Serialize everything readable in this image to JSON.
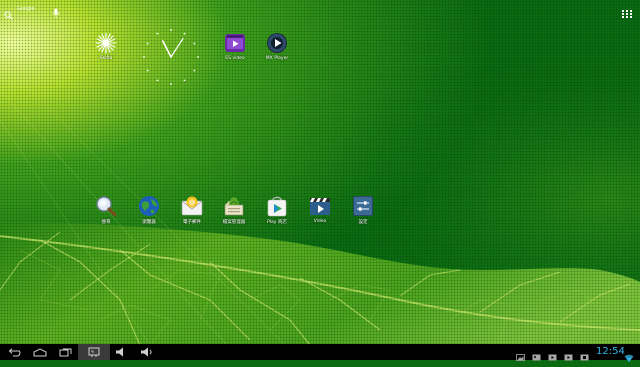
{
  "search": {
    "label": "Google"
  },
  "clock": {
    "hour_hand_angle": 333,
    "minute_hand_angle": 33
  },
  "top_apps": [
    {
      "label": "Skifta",
      "icon": "skifta-icon"
    },
    {
      "label": "ES video",
      "icon": "es-video-icon"
    },
    {
      "label": "MX Player",
      "icon": "mx-player-icon"
    }
  ],
  "dock_apps": [
    {
      "label": "搜尋",
      "icon": "search-app-icon"
    },
    {
      "label": "瀏覽器",
      "icon": "browser-icon"
    },
    {
      "label": "電子郵件",
      "icon": "email-icon"
    },
    {
      "label": "檔案管理器",
      "icon": "file-manager-icon"
    },
    {
      "label": "Play 商店",
      "icon": "play-store-icon"
    },
    {
      "label": "Video",
      "icon": "video-icon"
    },
    {
      "label": "設定",
      "icon": "settings-icon"
    }
  ],
  "status": {
    "time": "12:54"
  },
  "colors": {
    "clock_text": "#33b5e5",
    "navbar": "#000000"
  }
}
